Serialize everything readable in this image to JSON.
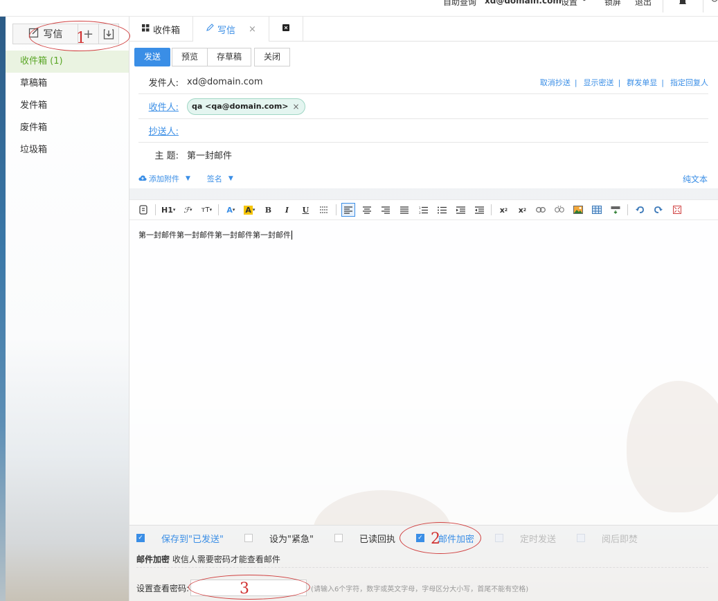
{
  "topbar": {
    "help": "自助查询",
    "account": "xd@domain.com",
    "settings": "设置",
    "lock": "锁屏",
    "logout": "退出"
  },
  "sidebar": {
    "compose_label": "写信",
    "folders": [
      {
        "label": "收件箱 (1)"
      },
      {
        "label": "草稿箱"
      },
      {
        "label": "发件箱"
      },
      {
        "label": "废件箱"
      },
      {
        "label": "垃圾箱"
      }
    ]
  },
  "tabs": [
    {
      "label": "收件箱"
    },
    {
      "label": "写信"
    }
  ],
  "toolbar": {
    "send": "发送",
    "preview": "预览",
    "save_draft": "存草稿",
    "close": "关闭"
  },
  "form": {
    "from_label": "发件人:",
    "from_value": "xd@domain.com",
    "to_label": "收件人:",
    "to_chip": "qa <qa@domain.com>",
    "cc_label": "抄送人:",
    "subject_label": "主 题:",
    "subject_value": "第一封邮件",
    "links": [
      "取消抄送",
      "显示密送",
      "群发单显",
      "指定回复人"
    ],
    "attach": "添加附件",
    "signature": "签名",
    "plain_text": "纯文本"
  },
  "editor": {
    "body": "第一封邮件第一封邮件第一封邮件第一封邮件"
  },
  "options": {
    "save_sent": "保存到\"已发送\"",
    "urgent": "设为\"紧急\"",
    "read_receipt": "已读回执",
    "encrypt": "邮件加密",
    "scheduled": "定时发送",
    "burn_after_read": "阅后即焚",
    "encrypt_note_bold": "邮件加密",
    "encrypt_note": "收信人需要密码才能查看邮件",
    "password_label": "设置查看密码:",
    "password_hint": "(请输入6个字符，数字或英文字母，字母区分大小写，首尾不能有空格)"
  },
  "annotations": [
    "1",
    "2",
    "3"
  ],
  "colors": {
    "accent": "#3a8ee6",
    "active_folder": "#5aa626",
    "annotation": "#d03030"
  }
}
